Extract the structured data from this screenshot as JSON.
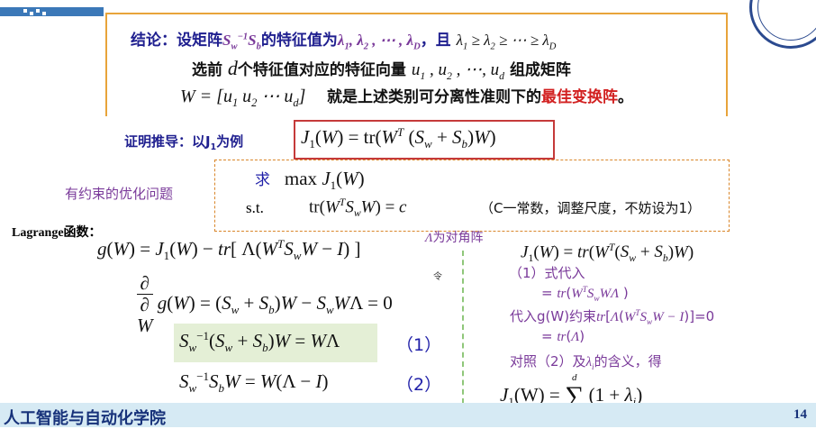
{
  "header": {
    "conclusion_prefix": "结论：设矩阵",
    "conclusion_eig": "的特征值为",
    "conclusion_and": "，且",
    "line2_a": "选前",
    "line2_b": "个特征值对应的特征向量",
    "line2_c": "组成矩阵",
    "line3_text": "就是上述类别可分离性准则下的",
    "line3_highlight": "最佳变换阵",
    "line3_end": "。"
  },
  "proof": {
    "label": "证明推导：以J",
    "label_tail": "为例"
  },
  "constraint": {
    "label": "有约束的优化问题",
    "qiu": "求",
    "st": "s.t.",
    "note": "（C一常数，调整尺度，不妨设为1）"
  },
  "lagrange": {
    "label": "Lagrange函数：",
    "lambda_note": "为对角阵",
    "ling": "令",
    "eq1_num": "（1）",
    "eq2_num": "（2）"
  },
  "right": {
    "step1": "（1）式代入",
    "step2_prefix": "代入g(W)约束",
    "step2_suffix": "=0",
    "step3_prefix": "对照（2）及",
    "step3_suffix": "的含义，得"
  },
  "footer": {
    "institute": "人工智能与自动化学院",
    "page": "14"
  },
  "colors": {
    "navy": "#1f1f8f",
    "purple": "#7a3a9a",
    "red_box": "#c53a3a",
    "orange": "#e8a43a",
    "footer_bg": "#d6eaf4",
    "eq1_bg": "#e4efd6"
  }
}
